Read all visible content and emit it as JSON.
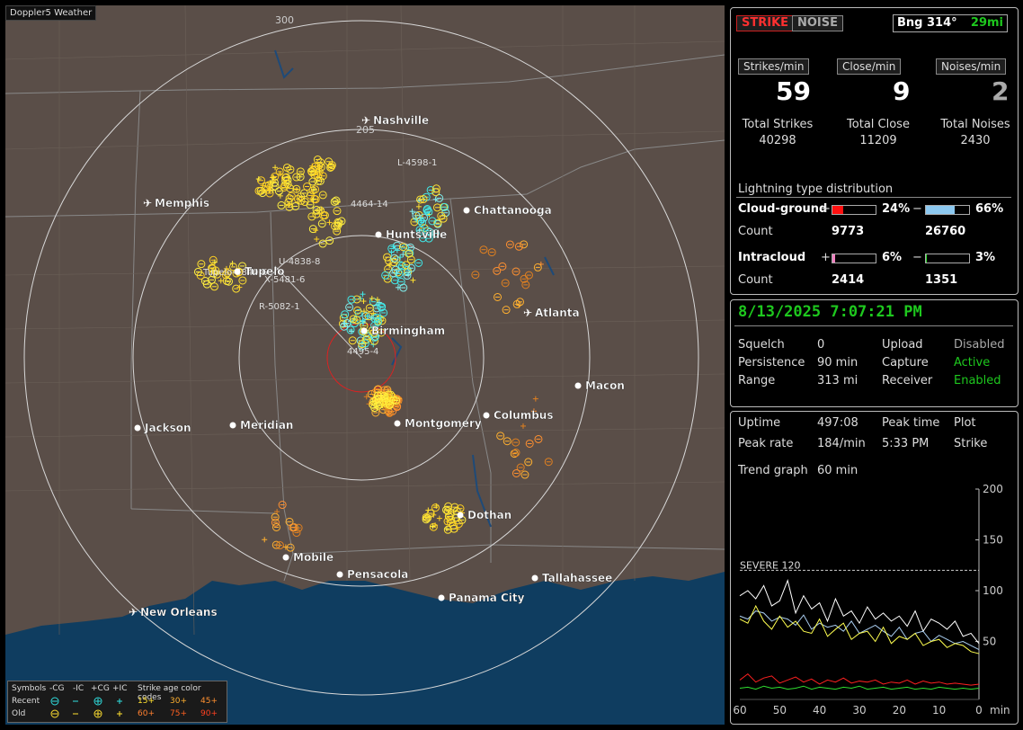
{
  "app_title": "Doppler5 Weather",
  "map": {
    "range_labels": [
      "300",
      "205"
    ],
    "cities": [
      {
        "name": "Nashville",
        "airport": true
      },
      {
        "name": "Memphis",
        "airport": true
      },
      {
        "name": "Chattanooga",
        "airport": false
      },
      {
        "name": "Huntsville",
        "airport": false
      },
      {
        "name": "Tupelo",
        "airport": false
      },
      {
        "name": "Atlanta",
        "airport": true
      },
      {
        "name": "Birmingham",
        "airport": false
      },
      {
        "name": "Macon",
        "airport": false
      },
      {
        "name": "Jackson",
        "airport": false
      },
      {
        "name": "Meridian",
        "airport": false
      },
      {
        "name": "Montgomery",
        "airport": false
      },
      {
        "name": "Columbus",
        "airport": false
      },
      {
        "name": "Dothan",
        "airport": false
      },
      {
        "name": "Mobile",
        "airport": false
      },
      {
        "name": "Pensacola",
        "airport": false
      },
      {
        "name": "Tallahassee",
        "airport": false
      },
      {
        "name": "Panama City",
        "airport": false
      },
      {
        "name": "New Orleans",
        "airport": true
      }
    ],
    "cell_labels": [
      "L-4598-1",
      "4464-14",
      "U-4838-8",
      "Tupelo-5840-6",
      "X-5481-6",
      "R-5082-1",
      "4495-4"
    ]
  },
  "legend": {
    "symbols_title": "Symbols",
    "sym_headers": [
      "-CG",
      "-IC",
      "+CG",
      "+IC"
    ],
    "age_title": "Strike age color codes",
    "rows": [
      {
        "label": "Recent",
        "ages": [
          "15+",
          "30+",
          "45+"
        ]
      },
      {
        "label": "Old",
        "ages": [
          "60+",
          "75+",
          "90+"
        ]
      }
    ]
  },
  "status": {
    "strike_btn": "STRIKE",
    "noise_btn": "NOISE",
    "bearing": "Bng 314°",
    "distance": "29mi",
    "rate_labels": [
      "Strikes/min",
      "Close/min",
      "Noises/min"
    ],
    "rates": [
      "59",
      "9",
      "2"
    ],
    "total_labels": [
      "Total Strikes",
      "Total Close",
      "Total Noises"
    ],
    "totals": [
      "40298",
      "11209",
      "2430"
    ],
    "dist_title": "Lightning type distribution",
    "cg_label": "Cloud-ground",
    "ic_label": "Intracloud",
    "count_label": "Count",
    "plus": "+",
    "minus": "−",
    "cg_pos_pct": "24%",
    "cg_neg_pct": "66%",
    "cg_pos_count": "9773",
    "cg_neg_count": "26760",
    "ic_pos_pct": "6%",
    "ic_neg_pct": "3%",
    "ic_pos_count": "2414",
    "ic_neg_count": "1351",
    "cg_pos_frac": 0.24,
    "cg_neg_frac": 0.66,
    "ic_pos_frac": 0.06,
    "ic_neg_frac": 0.03
  },
  "settings": {
    "datetime": "8/13/2025 7:07:21 PM",
    "squelch_label": "Squelch",
    "squelch": "0",
    "persistence_label": "Persistence",
    "persistence": "90 min",
    "range_label": "Range",
    "range": "313 mi",
    "upload_label": "Upload",
    "upload": "Disabled",
    "capture_label": "Capture",
    "capture": "Active",
    "receiver_label": "Receiver",
    "receiver": "Enabled"
  },
  "trend": {
    "uptime_label": "Uptime",
    "uptime": "497:08",
    "peak_time_label": "Peak time",
    "peak_time": "5:33 PM",
    "plot_label": "Plot",
    "plot": "Strike",
    "peak_rate_label": "Peak rate",
    "peak_rate": "184/min",
    "trend_label": "Trend graph",
    "trend_val": "60 min",
    "severe_label": "SEVERE 120",
    "unit": "min"
  },
  "chart_data": {
    "type": "line",
    "x": [
      60,
      58,
      56,
      54,
      52,
      50,
      48,
      46,
      44,
      42,
      40,
      38,
      36,
      34,
      32,
      30,
      28,
      26,
      24,
      22,
      20,
      18,
      16,
      14,
      12,
      10,
      8,
      6,
      4,
      2,
      0
    ],
    "x_ticks": [
      "60",
      "50",
      "40",
      "30",
      "20",
      "10",
      "0"
    ],
    "y_ticks": [
      "200",
      "150",
      "100",
      "50"
    ],
    "ylim": [
      0,
      200
    ],
    "severe_threshold": 120,
    "series": [
      {
        "color": "#ffffff",
        "values": [
          95,
          100,
          92,
          105,
          85,
          90,
          110,
          78,
          95,
          82,
          88,
          70,
          92,
          75,
          80,
          68,
          84,
          72,
          78,
          70,
          75,
          65,
          80,
          60,
          72,
          68,
          62,
          70,
          55,
          58,
          48
        ]
      },
      {
        "color": "#a9cdf0",
        "values": [
          75,
          72,
          80,
          78,
          70,
          74,
          72,
          66,
          76,
          62,
          68,
          64,
          66,
          60,
          70,
          58,
          62,
          66,
          60,
          55,
          64,
          52,
          58,
          60,
          50,
          56,
          52,
          48,
          50,
          46,
          42
        ]
      },
      {
        "color": "#ffff50",
        "values": [
          72,
          68,
          85,
          70,
          62,
          75,
          64,
          70,
          60,
          58,
          72,
          55,
          62,
          68,
          52,
          58,
          60,
          50,
          64,
          48,
          55,
          52,
          58,
          46,
          50,
          52,
          44,
          48,
          46,
          40,
          38
        ]
      },
      {
        "color": "#ff2020",
        "values": [
          12,
          18,
          10,
          14,
          16,
          9,
          12,
          15,
          10,
          13,
          8,
          12,
          10,
          14,
          9,
          11,
          10,
          12,
          8,
          10,
          9,
          12,
          8,
          11,
          9,
          10,
          8,
          9,
          8,
          7,
          8
        ]
      },
      {
        "color": "#30e030",
        "values": [
          4,
          5,
          3,
          6,
          4,
          5,
          3,
          4,
          6,
          3,
          5,
          4,
          3,
          5,
          4,
          6,
          3,
          4,
          5,
          3,
          4,
          5,
          3,
          4,
          3,
          5,
          4,
          3,
          4,
          3,
          4
        ]
      }
    ]
  }
}
